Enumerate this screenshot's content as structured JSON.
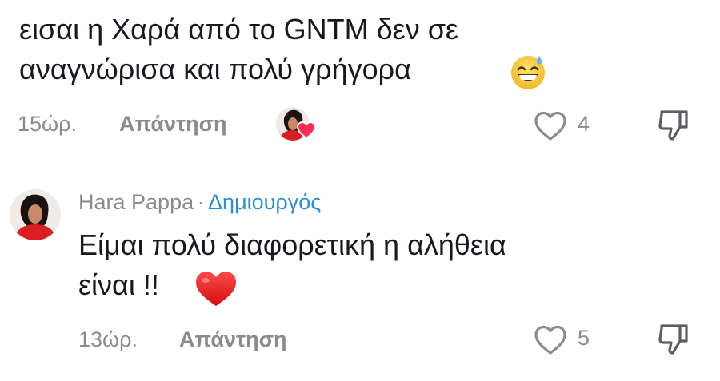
{
  "comment": {
    "line1": "εισαι η Χαρά από το GNTM δεν σε",
    "line2": "αναγνώρισα και πολύ γρήγορα",
    "emoji_icon": "grinning-sweat-emoji",
    "time": "15ώρ.",
    "reply_label": "Απάντηση",
    "like_count": "4"
  },
  "reply": {
    "author": "Hara Pappa",
    "separator": "·",
    "creator_label": "Δημιουργός",
    "line1": "Είμαι πολύ διαφορετική η αλήθεια",
    "line2": "είναι !!",
    "emoji_icon": "red-heart-emoji",
    "time": "13ώρ.",
    "reply_label": "Απάντηση",
    "like_count": "5"
  },
  "colors": {
    "text": "#161823",
    "muted": "#8a8b91",
    "creator": "#2a8fd6",
    "heart": "#fe2c55"
  }
}
